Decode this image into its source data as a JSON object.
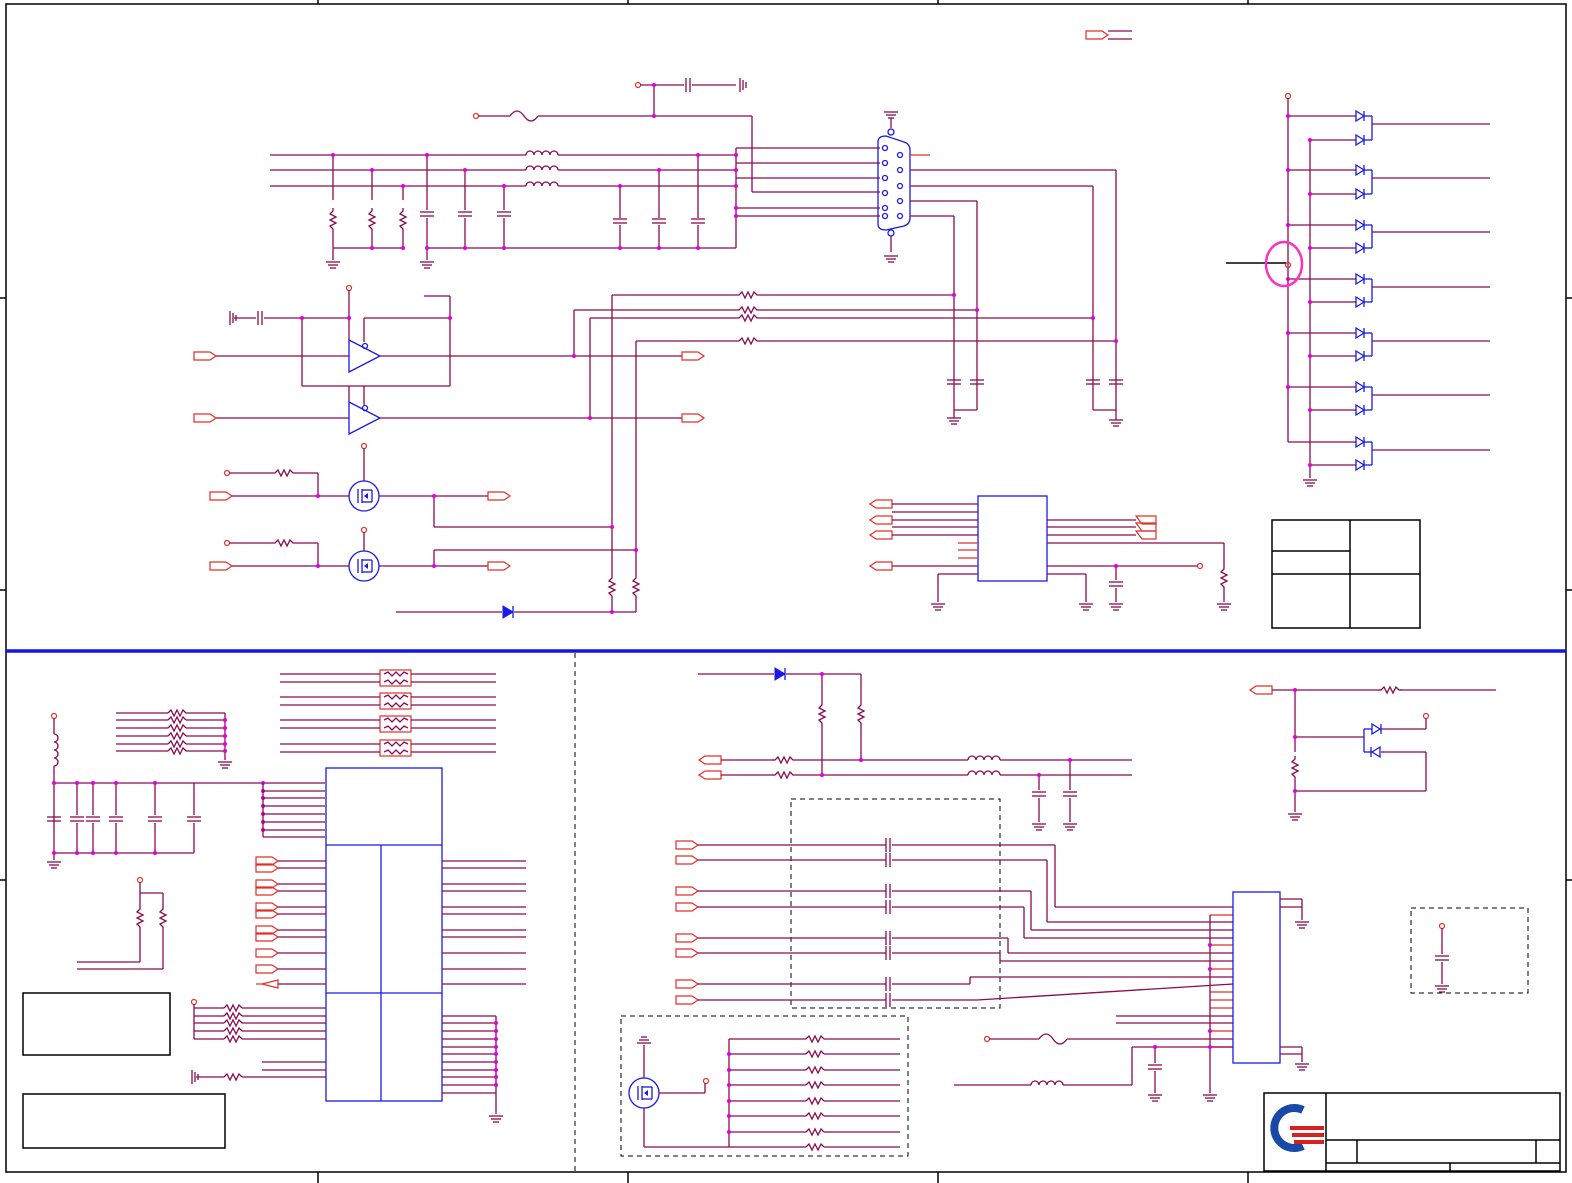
{
  "sheet": {
    "title": "",
    "border_color": "#000000",
    "wire_color": "#8b0a50",
    "pin_color": "#e0302a",
    "part_color": "#1a1ae6",
    "junction_color": "#e000e0",
    "highlight_color": "#ff30c0",
    "divider_color": "#1414e6"
  },
  "icons": {
    "logo": "company-logo-icon",
    "connector": "db15-connector-icon",
    "diode": "diode-icon",
    "mosfet": "mosfet-icon",
    "inductor": "inductor-icon",
    "resistor": "resistor-icon",
    "capacitor": "capacitor-icon",
    "ground": "ground-icon",
    "port": "port-arrow-icon"
  },
  "title_block": {
    "company": "",
    "sheet_title": "",
    "size": "",
    "document_number": "",
    "revision": ""
  }
}
